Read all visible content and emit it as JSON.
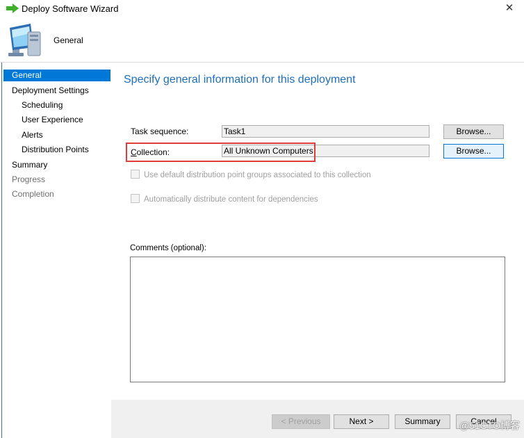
{
  "window": {
    "title": "Deploy Software Wizard",
    "close_glyph": "✕"
  },
  "header": {
    "title": "General"
  },
  "sidebar": {
    "items": [
      {
        "label": "General",
        "state": "active"
      },
      {
        "label": "Deployment Settings",
        "state": "normal"
      },
      {
        "label": "Scheduling",
        "state": "normal"
      },
      {
        "label": "User Experience",
        "state": "normal"
      },
      {
        "label": "Alerts",
        "state": "normal"
      },
      {
        "label": "Distribution Points",
        "state": "normal"
      },
      {
        "label": "Summary",
        "state": "normal"
      },
      {
        "label": "Progress",
        "state": "disabled"
      },
      {
        "label": "Completion",
        "state": "disabled"
      }
    ]
  },
  "main": {
    "heading": "Specify general information for this deployment",
    "task_sequence": {
      "label": "Task sequence:",
      "value": "Task1",
      "browse": "Browse..."
    },
    "collection": {
      "label": "Collection:",
      "value": "All Unknown Computers",
      "browse": "Browse..."
    },
    "checkbox_default_dp": {
      "label": "Use default distribution point groups associated to this collection",
      "checked": false,
      "enabled": false
    },
    "checkbox_auto_distribute": {
      "label": "Automatically distribute content for dependencies",
      "checked": false,
      "enabled": false
    },
    "comments": {
      "label": "Comments (optional):",
      "value": ""
    }
  },
  "footer": {
    "previous": "< Previous",
    "next": "Next >",
    "summary": "Summary",
    "cancel": "Cancel"
  },
  "watermark": "@51CTO博客",
  "colors": {
    "accent": "#0078d7",
    "heading": "#1e6fb8",
    "highlight": "#e23b3b",
    "footer_bg": "#f0f0f0"
  },
  "icons": {
    "title": "green-arrow-icon",
    "header": "computer-monitor-icon"
  }
}
